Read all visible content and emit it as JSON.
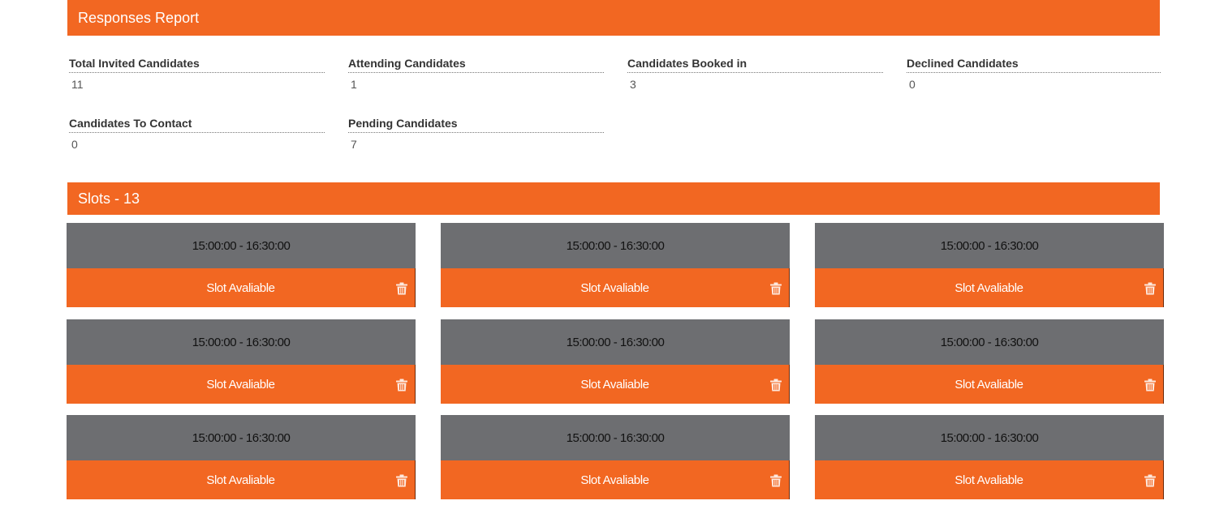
{
  "responses_report": {
    "title": "Responses Report",
    "stats": [
      {
        "label": "Total Invited Candidates",
        "value": "11"
      },
      {
        "label": "Attending Candidates",
        "value": "1"
      },
      {
        "label": "Candidates Booked in",
        "value": "3"
      },
      {
        "label": "Declined Candidates",
        "value": "0"
      },
      {
        "label": "Candidates To Contact",
        "value": "0"
      },
      {
        "label": "Pending Candidates",
        "value": "7"
      }
    ]
  },
  "slots": {
    "title": "Slots - 13",
    "items": [
      {
        "time": "15:00:00 - 16:30:00",
        "status": "Slot Avaliable",
        "icon": "trash-icon"
      },
      {
        "time": "15:00:00 - 16:30:00",
        "status": "Slot Avaliable",
        "icon": "trash-icon"
      },
      {
        "time": "15:00:00 - 16:30:00",
        "status": "Slot Avaliable",
        "icon": "trash-icon"
      },
      {
        "time": "15:00:00 - 16:30:00",
        "status": "Slot Avaliable",
        "icon": "trash-icon"
      },
      {
        "time": "15:00:00 - 16:30:00",
        "status": "Slot Avaliable",
        "icon": "trash-icon"
      },
      {
        "time": "15:00:00 - 16:30:00",
        "status": "Slot Avaliable",
        "icon": "trash-icon"
      },
      {
        "time": "15:00:00 - 16:30:00",
        "status": "Slot Avaliable",
        "icon": "trash-icon"
      },
      {
        "time": "15:00:00 - 16:30:00",
        "status": "Slot Avaliable",
        "icon": "trash-icon"
      },
      {
        "time": "15:00:00 - 16:30:00",
        "status": "Slot Avaliable",
        "icon": "trash-icon"
      }
    ]
  },
  "colors": {
    "accent": "#f26722",
    "slot_time_bg": "#6d6e71"
  }
}
